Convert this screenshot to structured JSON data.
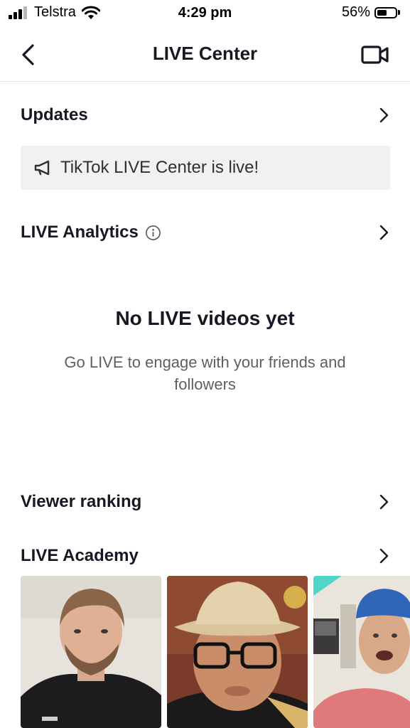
{
  "status_bar": {
    "carrier": "Telstra",
    "time": "4:29 pm",
    "battery_percent": "56%",
    "battery_level": 0.56,
    "signal_bars": 3,
    "icons": [
      "cellular-signal-icon",
      "wifi-icon",
      "battery-icon"
    ]
  },
  "nav": {
    "title": "LIVE Center",
    "back_icon": "chevron-left-icon",
    "action_icon": "video-camera-icon"
  },
  "updates": {
    "label": "Updates",
    "banner_text": "TikTok LIVE Center is live!",
    "banner_icon": "megaphone-icon"
  },
  "analytics": {
    "label": "LIVE Analytics",
    "info_icon": "info-icon"
  },
  "empty_state": {
    "title": "No LIVE videos yet",
    "subtitle": "Go LIVE to engage with your friends and followers"
  },
  "viewer_ranking": {
    "label": "Viewer ranking"
  },
  "academy": {
    "label": "LIVE Academy",
    "thumbnails": [
      {
        "name": "academy-video-1"
      },
      {
        "name": "academy-video-2"
      },
      {
        "name": "academy-video-3"
      }
    ]
  },
  "colors": {
    "text_primary": "#161823",
    "text_secondary": "#5e5f66",
    "banner_bg": "#f1f1f2",
    "divider": "#e3e3e4"
  }
}
